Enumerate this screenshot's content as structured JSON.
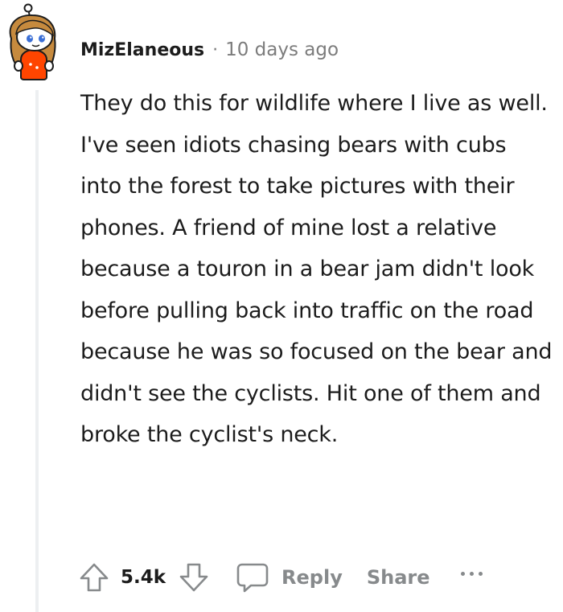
{
  "comment": {
    "author": "MizElaneous",
    "separator": "·",
    "timestamp": "10 days ago",
    "body": "They do this for wildlife where I live as well. I've seen idiots chasing bears with cubs into the forest to take pictures with their phones. A friend of mine lost a relative because a touron in a bear jam didn't look before pulling back into traffic on the road because he was so focused on the bear and didn't see the cyclists. Hit one of them and broke the cyclist's neck.",
    "score": "5.4k"
  },
  "actions": {
    "upvote_icon": "arrow-up-icon",
    "downvote_icon": "arrow-down-icon",
    "reply_icon": "speech-bubble-icon",
    "reply_label": "Reply",
    "share_label": "Share",
    "more_icon": "ellipsis-icon"
  },
  "colors": {
    "text": "#1c1c1c",
    "muted": "#7c7c7c",
    "action": "#878a8c",
    "thread_line": "#edeff1",
    "avatar_shirt": "#ff4500",
    "avatar_hair": "#c68a3e"
  }
}
